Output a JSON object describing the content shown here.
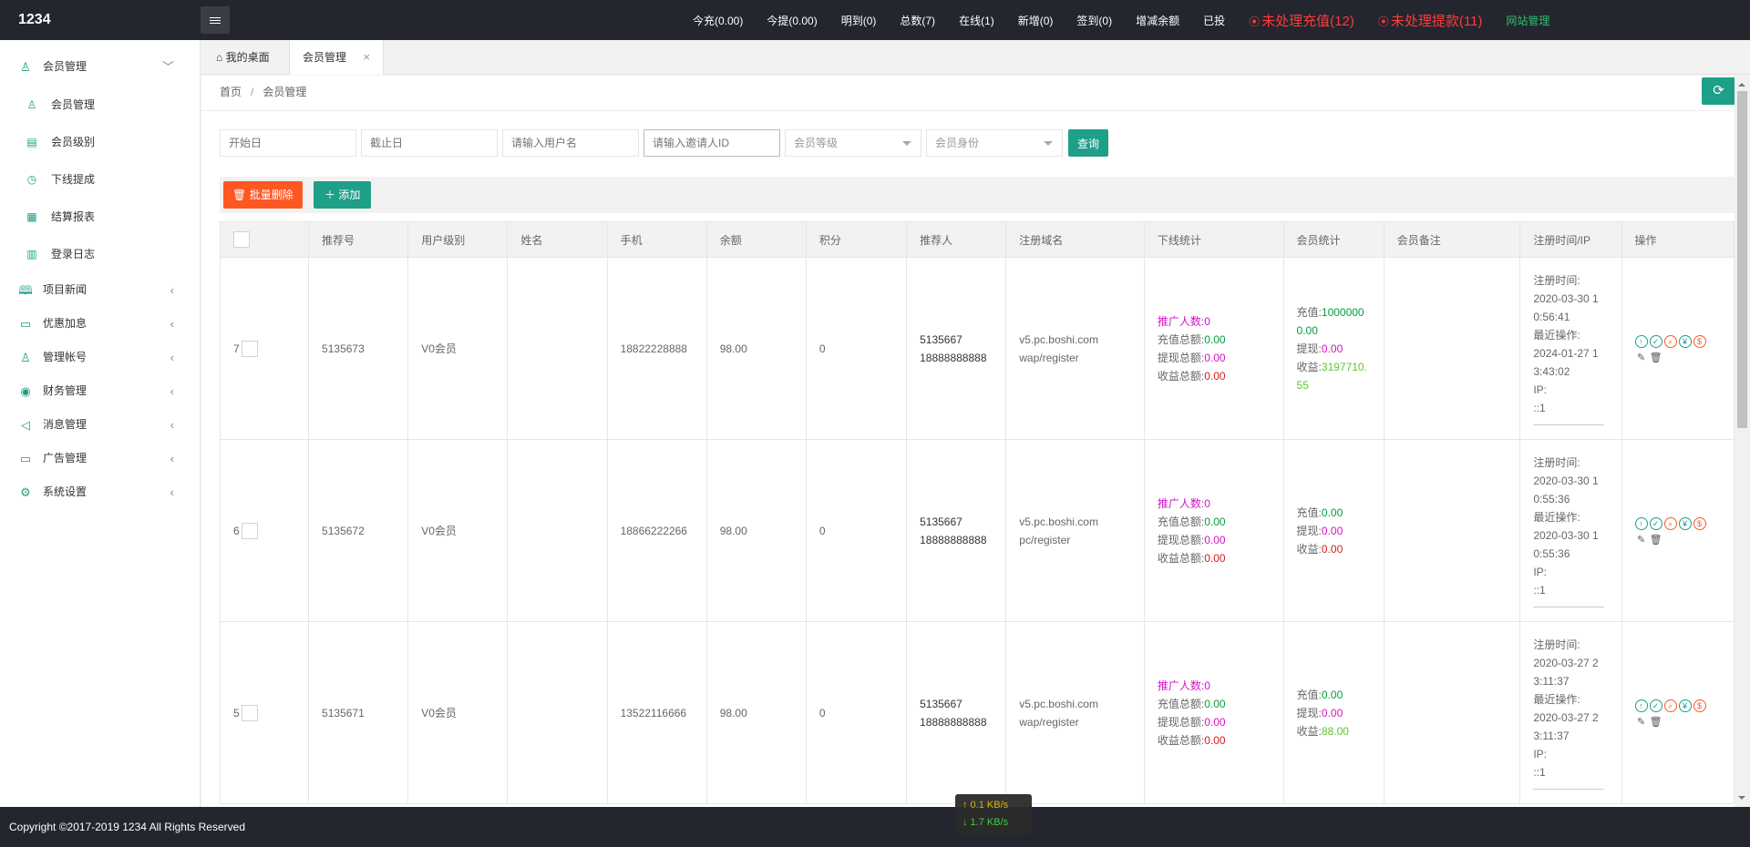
{
  "header": {
    "logo": "1234",
    "stats": [
      {
        "label": "今充(0.00)",
        "kind": "normal"
      },
      {
        "label": "今提(0.00)",
        "kind": "normal"
      },
      {
        "label": "明到(0)",
        "kind": "normal"
      },
      {
        "label": "总数(7)",
        "kind": "normal"
      },
      {
        "label": "在线(1)",
        "kind": "normal"
      },
      {
        "label": "新增(0)",
        "kind": "normal"
      },
      {
        "label": "签到(0)",
        "kind": "normal"
      },
      {
        "label": "增减余额",
        "kind": "normal"
      },
      {
        "label": "已投",
        "kind": "normal"
      },
      {
        "label": "未处理充值(12)",
        "kind": "alert"
      },
      {
        "label": "未处理提款(11)",
        "kind": "alert"
      },
      {
        "label": "网站管理",
        "kind": "site"
      }
    ]
  },
  "sidebar": {
    "group_member": {
      "label": "会员管理",
      "icon": "user-icon",
      "arrow": "﹀"
    },
    "subs": [
      {
        "label": "会员管理",
        "icon": "user-icon"
      },
      {
        "label": "会员级别",
        "icon": "level-icon"
      },
      {
        "label": "下线提成",
        "icon": "gauge-icon"
      },
      {
        "label": "结算报表",
        "icon": "report-icon"
      },
      {
        "label": "登录日志",
        "icon": "calendar-icon"
      }
    ],
    "groups": [
      {
        "label": "项目新闻",
        "icon": "book-icon"
      },
      {
        "label": "优惠加息",
        "icon": "image-icon"
      },
      {
        "label": "管理帐号",
        "icon": "users-icon"
      },
      {
        "label": "财务管理",
        "icon": "money-icon"
      },
      {
        "label": "消息管理",
        "icon": "speaker-icon"
      },
      {
        "label": "广告管理",
        "icon": "picture-icon"
      },
      {
        "label": "系统设置",
        "icon": "gear-icon"
      }
    ]
  },
  "tabs": {
    "home": "我的桌面",
    "active": "会员管理",
    "close": "×"
  },
  "breadcrumb": {
    "home": "首页",
    "sep": "/",
    "current": "会员管理"
  },
  "filters": {
    "start_date": "开始日",
    "end_date": "截止日",
    "username": "请输入用户名",
    "inviter_id": "请输入邀请人ID",
    "level": "会员等级",
    "identity": "会员身份",
    "query": "查询"
  },
  "toolbar": {
    "batch_delete": "批量删除",
    "add": "添加"
  },
  "table": {
    "headers": [
      "",
      "推荐号",
      "用户级别",
      "姓名",
      "手机",
      "余额",
      "积分",
      "推荐人",
      "注册域名",
      "下线统计",
      "会员统计",
      "会员备注",
      "注册时间/IP",
      "操作"
    ],
    "labels": {
      "promo_count": "推广人数:",
      "recharge_total": "充值总额:",
      "withdraw_total": "提现总额:",
      "profit_total": "收益总额:",
      "recharge": "充值:",
      "withdraw": "提现:",
      "profit": "收益:",
      "reg_time": "注册时间:",
      "last_op": "最近操作:",
      "ip": "IP:"
    },
    "rows": [
      {
        "idx": "7",
        "ref_no": "5135673",
        "level": "V0会员",
        "name": "",
        "phone": "18822228888",
        "balance": "98.00",
        "points": "0",
        "referrer_id": "5135667",
        "referrer_phone": "18888888888",
        "domain": "v5.pc.boshi.com",
        "path": "wap/register",
        "promo": "0",
        "rc_total": "0.00",
        "wd_total": "0.00",
        "pf_total": "0.00",
        "rc": "1000000 0.00",
        "wd": "0.00",
        "pf": "3197710. 55",
        "note": "",
        "reg_time": "2020-03-30 1 0:56:41",
        "last_op": "2024-01-27 1 3:43:02",
        "ip": "::1"
      },
      {
        "idx": "6",
        "ref_no": "5135672",
        "level": "V0会员",
        "name": "",
        "phone": "18866222266",
        "balance": "98.00",
        "points": "0",
        "referrer_id": "5135667",
        "referrer_phone": "18888888888",
        "domain": "v5.pc.boshi.com",
        "path": "pc/register",
        "promo": "0",
        "rc_total": "0.00",
        "wd_total": "0.00",
        "pf_total": "0.00",
        "rc": "0.00",
        "wd": "0.00",
        "pf": "0.00",
        "note": "",
        "reg_time": "2020-03-30 1 0:55:36",
        "last_op": "2020-03-30 1 0:55:36",
        "ip": "::1"
      },
      {
        "idx": "5",
        "ref_no": "5135671",
        "level": "V0会员",
        "name": "",
        "phone": "13522116666",
        "balance": "98.00",
        "points": "0",
        "referrer_id": "5135667",
        "referrer_phone": "18888888888",
        "domain": "v5.pc.boshi.com",
        "path": "wap/register",
        "promo": "0",
        "rc_total": "0.00",
        "wd_total": "0.00",
        "pf_total": "0.00",
        "rc": "0.00",
        "wd": "0.00",
        "pf": "88.00",
        "note": "",
        "reg_time": "2020-03-27 2 3:11:37",
        "last_op": "2020-03-27 2 3:11:37",
        "ip": "::1"
      }
    ]
  },
  "footer": {
    "copyright": "Copyright ©2017-2019 1234 All Rights Reserved"
  },
  "netspeed": {
    "up": "↑ 0.1 KB/s",
    "down": "↓ 1.7 KB/s"
  }
}
